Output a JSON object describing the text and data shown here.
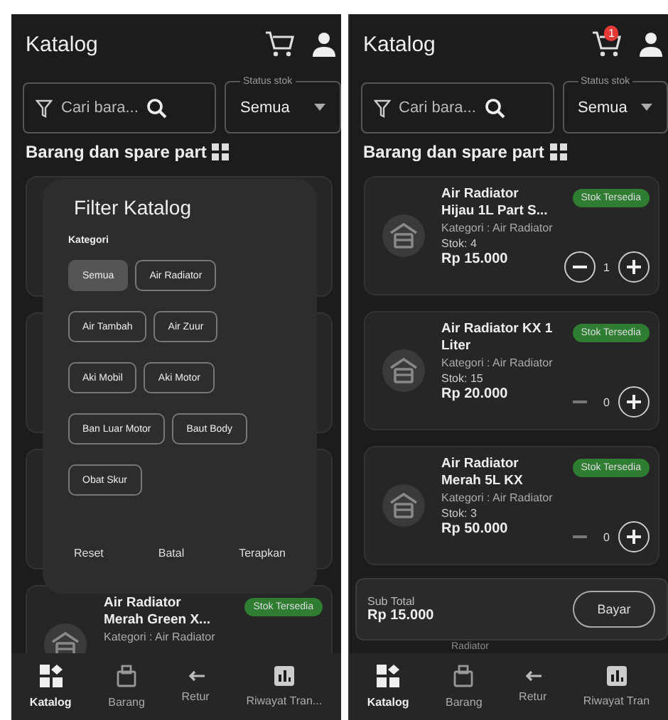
{
  "screens": [
    {
      "header": {
        "title": "Katalog"
      },
      "search": {
        "placeholder": "Cari bara..."
      },
      "status_filter": {
        "label": "Status stok",
        "value": "Semua"
      },
      "section_title": "Barang dan spare part",
      "products": [
        {
          "kind": "hidden"
        },
        {
          "kind": "hidden"
        },
        {
          "kind": "hidden"
        },
        {
          "kind": "card",
          "name": "Air Radiator Merah Green X...",
          "category": "Kategori : Air Radiator",
          "badge": "Stok Tersedia"
        }
      ],
      "filter_dialog": {
        "title": "Filter Katalog",
        "group_label": "Kategori",
        "chips": [
          {
            "label": "Semua",
            "selected": true
          },
          {
            "label": "Air Radiator",
            "selected": false
          },
          {
            "label": "Air Tambah",
            "selected": false
          },
          {
            "label": "Air Zuur",
            "selected": false
          },
          {
            "label": "Aki Mobil",
            "selected": false
          },
          {
            "label": "Aki Motor",
            "selected": false
          },
          {
            "label": "Ban Luar Motor",
            "selected": false
          },
          {
            "label": "Baut Body",
            "selected": false
          },
          {
            "label": "Obat Skur",
            "selected": false
          }
        ],
        "actions": [
          "Reset",
          "Batal",
          "Terapkan"
        ]
      },
      "nav": [
        {
          "label": "Katalog",
          "selected": true
        },
        {
          "label": "Barang",
          "selected": false
        },
        {
          "label": "Retur",
          "selected": false
        },
        {
          "label": "Riwayat Tran...",
          "selected": false
        }
      ]
    },
    {
      "header": {
        "title": "Katalog",
        "cart_badge": "1"
      },
      "search": {
        "placeholder": "Cari bara..."
      },
      "status_filter": {
        "label": "Status stok",
        "value": "Semua"
      },
      "section_title": "Barang dan spare part",
      "products": [
        {
          "kind": "card",
          "name": "Air Radiator Hijau 1L Part S...",
          "category": "Kategori : Air Radiator",
          "stock": "Stok: 4",
          "price": "Rp 15.000",
          "badge": "Stok Tersedia",
          "quantity": "1",
          "minus_disabled": false
        },
        {
          "kind": "card",
          "name": "Air Radiator KX 1 Liter",
          "category": "Kategori : Air Radiator",
          "stock": "Stok: 15",
          "price": "Rp 20.000",
          "badge": "Stok Tersedia",
          "quantity": "0",
          "minus_disabled": true
        },
        {
          "kind": "card",
          "name": "Air Radiator Merah 5L KX",
          "category": "Kategori : Air Radiator",
          "stock": "Stok: 3",
          "price": "Rp 50.000",
          "badge": "Stok Tersedia",
          "quantity": "0",
          "minus_disabled": true
        }
      ],
      "subtotal": {
        "label": "Sub Total",
        "value": "Rp 15.000",
        "button": "Bayar"
      },
      "behind_text": "Radiator",
      "nav": [
        {
          "label": "Katalog",
          "selected": true
        },
        {
          "label": "Barang",
          "selected": false
        },
        {
          "label": "Retur",
          "selected": false
        },
        {
          "label": "Riwayat Tran",
          "selected": false
        }
      ]
    }
  ]
}
